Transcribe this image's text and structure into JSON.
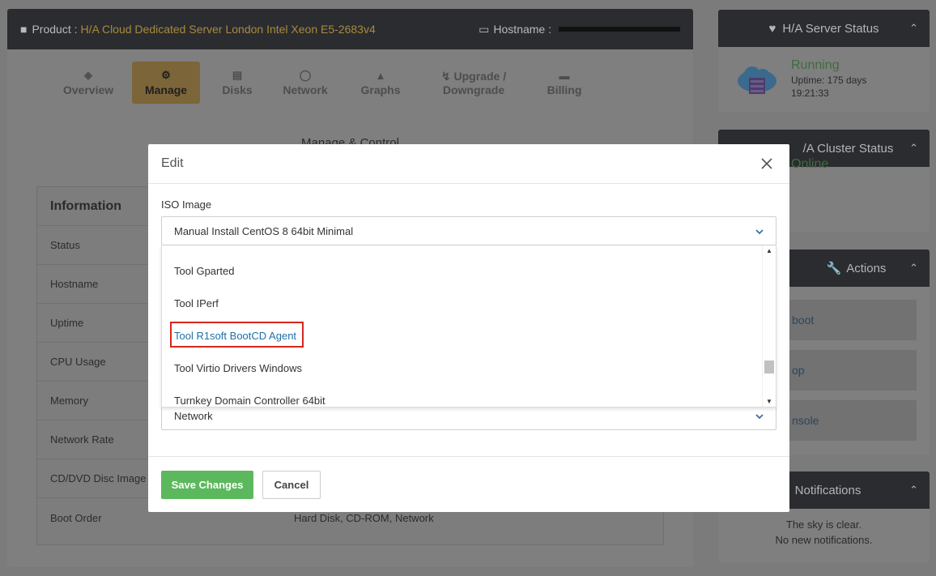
{
  "product": {
    "label": "Product :",
    "name": "H/A Cloud Dedicated Server London Intel Xeon E5-2683v4",
    "hostname_label": "Hostname :"
  },
  "tabs": [
    {
      "label": "Overview",
      "icon": "cubes-icon"
    },
    {
      "label": "Manage",
      "icon": "cogs-icon"
    },
    {
      "label": "Disks",
      "icon": "hdd-icon"
    },
    {
      "label": "Network",
      "icon": "globe-icon"
    },
    {
      "label": "Graphs",
      "icon": "chart-icon"
    },
    {
      "label": "Upgrade /",
      "label2": "Downgrade",
      "icon": "bolt-icon"
    },
    {
      "label": "Billing",
      "icon": "card-icon"
    }
  ],
  "section_title": "Manage & Control",
  "info": {
    "title": "Information",
    "rows": [
      {
        "label": "Status",
        "value": ""
      },
      {
        "label": "Hostname",
        "value": ""
      },
      {
        "label": "Uptime",
        "value": ""
      },
      {
        "label": "CPU Usage",
        "value": ""
      },
      {
        "label": "Memory",
        "value": ""
      },
      {
        "label": "Network Rate",
        "value": ""
      },
      {
        "label": "CD/DVD Disc Image F",
        "value": ""
      },
      {
        "label": "Boot Order",
        "value": "Hard Disk, CD-ROM, Network"
      }
    ]
  },
  "sidebar": {
    "server_status": {
      "title": "H/A Server Status",
      "state": "Running",
      "uptime_line1": "Uptime: 175 days",
      "uptime_line2": "19:21:33"
    },
    "cluster_status": {
      "title": "H/A Cluster Status",
      "title_visible": "/A Cluster Status",
      "state": "Online"
    },
    "actions": {
      "title": "Actions",
      "items": [
        "boot",
        "op",
        "nsole"
      ]
    },
    "notifications": {
      "title": "Notifications",
      "line1": "The sky is clear.",
      "line2": "No new notifications."
    }
  },
  "modal": {
    "title": "Edit",
    "iso_label": "ISO Image",
    "iso_selected": "Manual Install CentOS 8 64bit Minimal",
    "dropdown_items": [
      "Tool Gparted",
      "Tool IPerf",
      "Tool R1soft BootCD Agent",
      "Tool Virtio Drivers Windows",
      "Turnkey Domain Controller 64bit"
    ],
    "boot_selected": "Network",
    "save_label": "Save Changes",
    "cancel_label": "Cancel"
  },
  "colors": {
    "accent_gold": "#c9a95c",
    "save_green": "#5cb85c",
    "highlight_red": "#d7261e",
    "link_blue": "#1f6fa7"
  }
}
